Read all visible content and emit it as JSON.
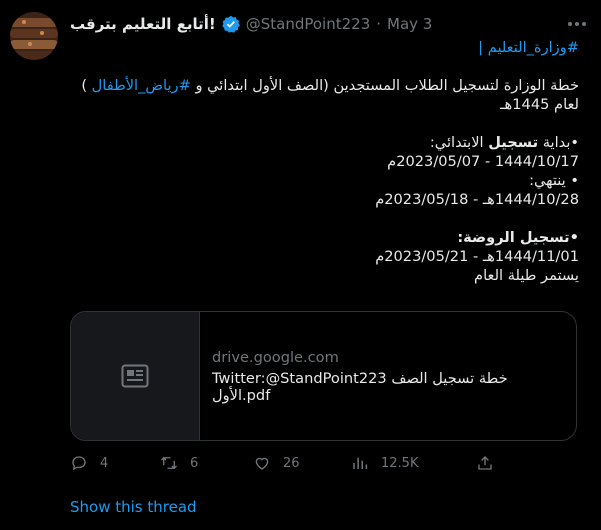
{
  "author": {
    "display_name": "أتابع التعليم بترقب!",
    "handle": "@StandPoint223",
    "separator": "·",
    "date": "May 3"
  },
  "tweet": {
    "hashtag_line": "#وزارة_التعليم |",
    "line1_a": "خطة الوزارة لتسجيل الطلاب المستجدين (الصف الأول ابتدائي و ",
    "line1_hashtag": "#رياض_الأطفال",
    "line1_b": " )",
    "line2": "لعام 1445هـ",
    "primary_heading_prefix": "•بداية ",
    "primary_heading_bold": "تسجيل",
    "primary_heading_suffix": " الابتدائي:",
    "primary_start_dates": "1444/10/17 - 2023/05/07م",
    "ends_label": "• ينتهي:",
    "primary_end_dates": "1444/10/28هـ - 2023/05/18م",
    "kg_heading": "•تسجيل الروضة:",
    "kg_dates": "1444/11/01هـ - 2023/05/21م",
    "kg_note": "يستمر طيلة العام"
  },
  "card": {
    "domain": "drive.google.com",
    "title": "Twitter:@StandPoint223 خطة تسجيل الصف الأول.pdf"
  },
  "actions": {
    "replies": "4",
    "retweets": "6",
    "likes": "26",
    "views": "12.5K"
  },
  "show_thread": "Show this thread",
  "colors": {
    "background": "#000000",
    "accent": "#1d9bf0",
    "muted": "#71767b",
    "border": "#2f3336"
  },
  "icons": [
    "verified-badge-icon",
    "more-icon",
    "document-icon",
    "reply-icon",
    "retweet-icon",
    "like-icon",
    "views-icon",
    "share-icon"
  ]
}
